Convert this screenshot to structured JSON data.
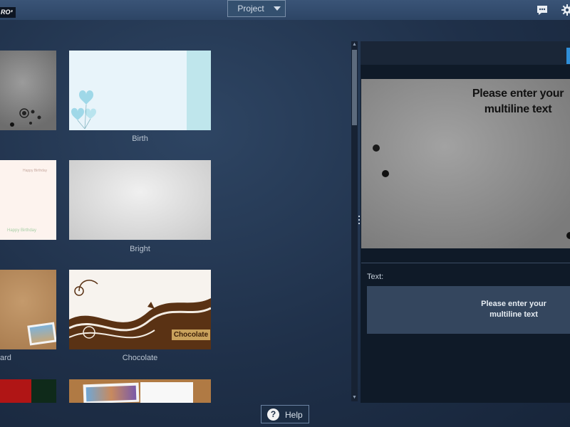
{
  "app": {
    "logo_text": "RO³"
  },
  "header": {
    "project_select": {
      "value": "Project"
    },
    "icons": [
      "chat-icon",
      "gear-icon"
    ]
  },
  "templates": [
    {
      "label": "",
      "style": "grunge"
    },
    {
      "label": "Birth",
      "style": "birth"
    },
    {
      "label": "",
      "style": "birthday"
    },
    {
      "label": "Bright",
      "style": "bright"
    },
    {
      "label": "ard",
      "style": "cork"
    },
    {
      "label": "Chocolate",
      "style": "chocolate"
    },
    {
      "label": "",
      "style": "red"
    },
    {
      "label": "",
      "style": "photos"
    }
  ],
  "thumb_text": {
    "birthday_top": "Happy Birthday",
    "birthday_bottom": "Happy Birthday",
    "chocolate_badge": "Chocolate"
  },
  "preview": {
    "text": "Please enter your multiline text"
  },
  "text_panel": {
    "label": "Text:",
    "value": "Please enter your multiline text"
  },
  "help": {
    "label": "Help"
  },
  "colors": {
    "accent": "#2f8fd9",
    "background": "#1f3049",
    "panel": "#0f1a28"
  }
}
